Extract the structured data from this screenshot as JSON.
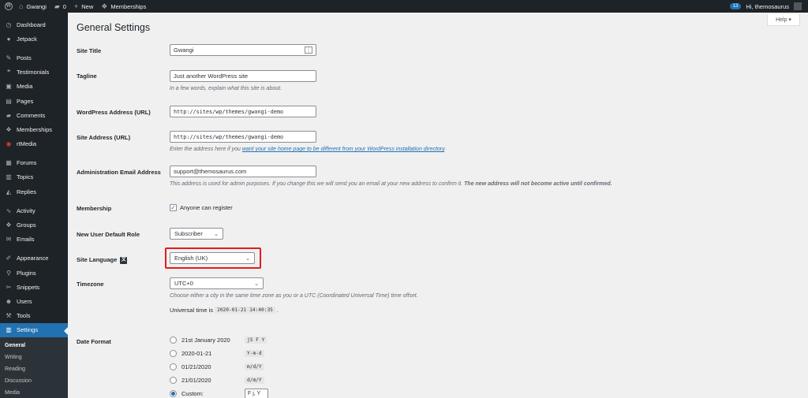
{
  "adminbar": {
    "site_name": "Gwangi",
    "comments_count": "0",
    "new_label": "New",
    "memberships_label": "Memberships",
    "notifications_count": "13",
    "greeting": "Hi, themosaurus"
  },
  "sidebar": {
    "items": [
      {
        "label": "Dashboard",
        "icon": "dashboard-icon"
      },
      {
        "label": "Jetpack",
        "icon": "jetpack-icon"
      },
      {
        "label": "Posts",
        "icon": "pin-icon"
      },
      {
        "label": "Testimonials",
        "icon": "quote-icon"
      },
      {
        "label": "Media",
        "icon": "media-icon"
      },
      {
        "label": "Pages",
        "icon": "page-icon"
      },
      {
        "label": "Comments",
        "icon": "comment-icon"
      },
      {
        "label": "Memberships",
        "icon": "groups-icon"
      },
      {
        "label": "rtMedia",
        "icon": "rtmedia-icon"
      },
      {
        "label": "Forums",
        "icon": "forums-icon"
      },
      {
        "label": "Topics",
        "icon": "topics-icon"
      },
      {
        "label": "Replies",
        "icon": "replies-icon"
      },
      {
        "label": "Activity",
        "icon": "activity-icon"
      },
      {
        "label": "Groups",
        "icon": "groups-icon"
      },
      {
        "label": "Emails",
        "icon": "email-icon"
      },
      {
        "label": "Appearance",
        "icon": "brush-icon"
      },
      {
        "label": "Plugins",
        "icon": "plugin-icon"
      },
      {
        "label": "Snippets",
        "icon": "snippet-icon"
      },
      {
        "label": "Users",
        "icon": "user-icon"
      },
      {
        "label": "Tools",
        "icon": "wrench-icon"
      },
      {
        "label": "Settings",
        "icon": "settings-icon"
      }
    ],
    "submenu": [
      "General",
      "Writing",
      "Reading",
      "Discussion",
      "Media"
    ]
  },
  "help_label": "Help",
  "page_title": "General Settings",
  "form": {
    "site_title": {
      "label": "Site Title",
      "value": "Gwangi"
    },
    "tagline": {
      "label": "Tagline",
      "value": "Just another WordPress site",
      "desc": "In a few words, explain what this site is about."
    },
    "wp_address": {
      "label": "WordPress Address (URL)",
      "value": "http://sites/wp/themes/gwangi-demo"
    },
    "site_address": {
      "label": "Site Address (URL)",
      "value": "http://sites/wp/themes/gwangi-demo",
      "desc_pre": "Enter the address here if you ",
      "desc_link": "want your site home page to be different from your WordPress installation directory",
      "desc_post": "."
    },
    "admin_email": {
      "label": "Administration Email Address",
      "value": "support@themosaurus.com",
      "desc_pre": "This address is used for admin purposes. If you change this we will send you an email at your new address to confirm it. ",
      "desc_bold": "The new address will not become active until confirmed."
    },
    "membership": {
      "label": "Membership",
      "checkbox_label": "Anyone can register"
    },
    "default_role": {
      "label": "New User Default Role",
      "value": "Subscriber"
    },
    "site_language": {
      "label": "Site Language",
      "value": "English (UK)"
    },
    "timezone": {
      "label": "Timezone",
      "value": "UTC+0",
      "desc": "Choose either a city in the same time zone as you or a UTC (Coordinated Universal Time) time offset.",
      "universal_label": "Universal time is",
      "universal_value": "2020-01-21 14:40:35",
      "universal_suffix": "."
    },
    "date_format": {
      "label": "Date Format",
      "options": [
        {
          "label": "21st January 2020",
          "code": "jS F Y"
        },
        {
          "label": "2020-01-21",
          "code": "Y-m-d"
        },
        {
          "label": "01/21/2020",
          "code": "m/d/Y"
        },
        {
          "label": "21/01/2020",
          "code": "d/m/Y"
        }
      ],
      "custom_label": "Custom:",
      "custom_value": "F j, Y"
    }
  },
  "colors": {
    "accent": "#2271b1",
    "adminbar": "#1d2327",
    "highlight": "#e21c1c"
  }
}
